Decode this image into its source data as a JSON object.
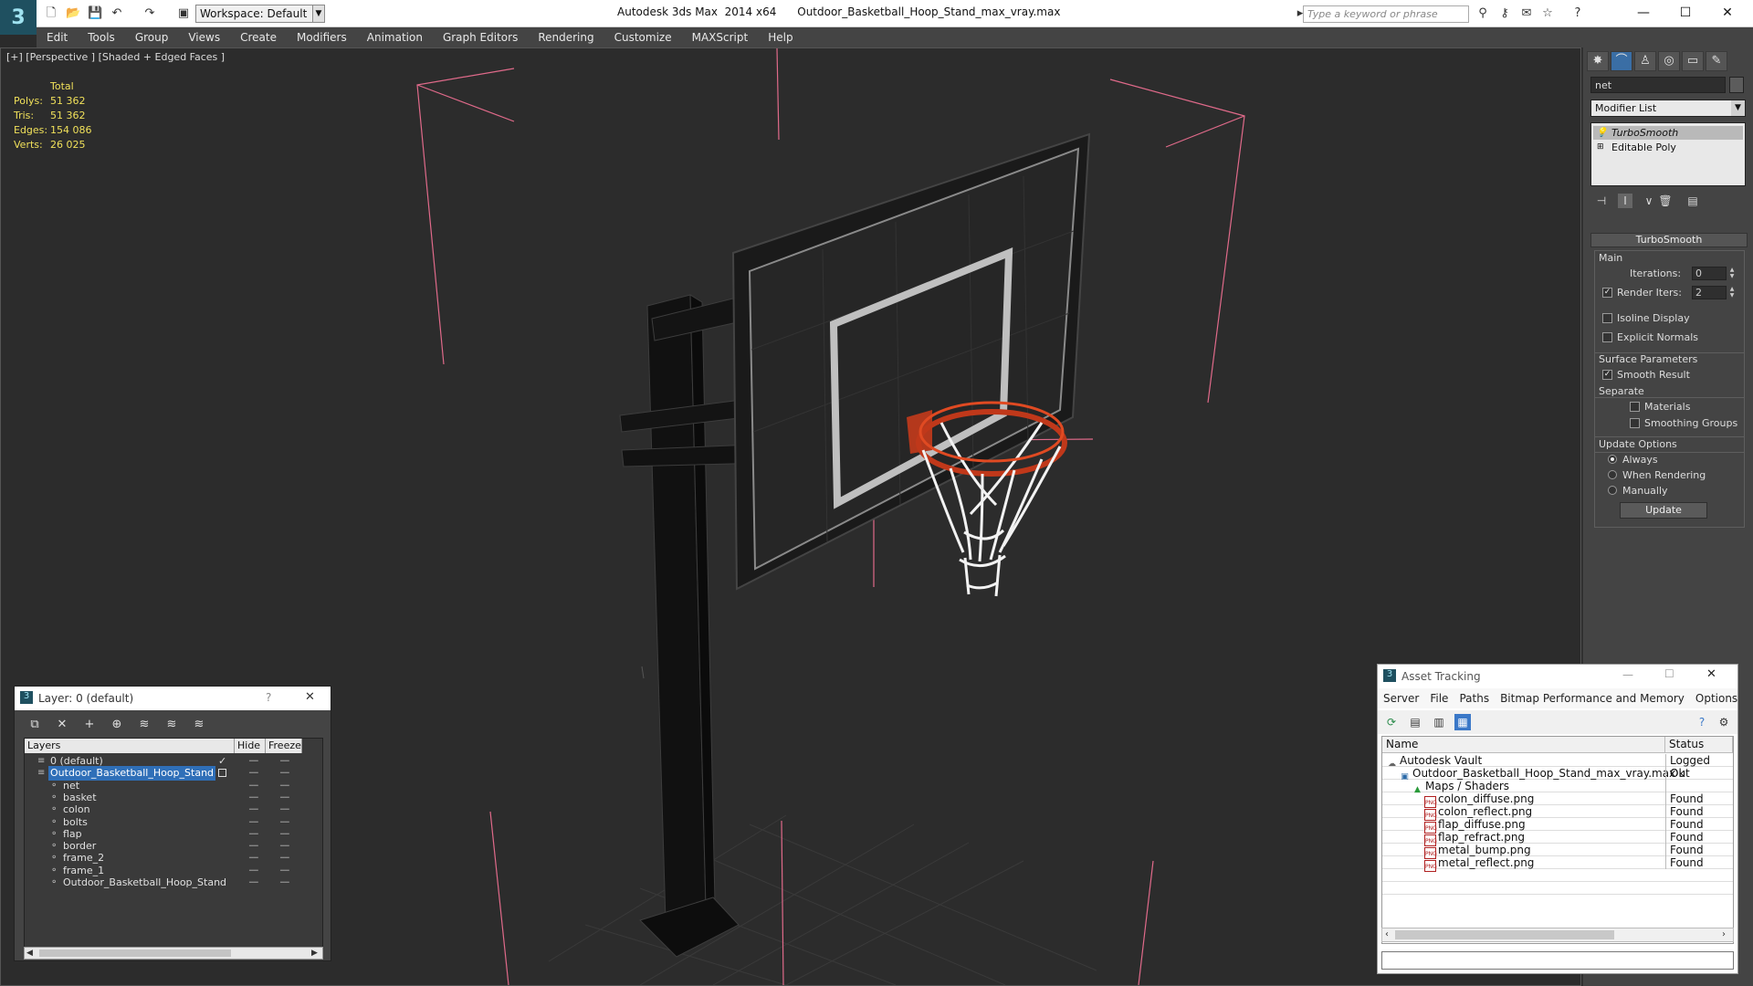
{
  "titlebar": {
    "workspace": "Workspace: Default",
    "window_title": "Autodesk 3ds Max  2014 x64      Outdoor_Basketball_Hoop_Stand_max_vray.max",
    "search_placeholder": "Type a keyword or phrase"
  },
  "menu": [
    "Edit",
    "Tools",
    "Group",
    "Views",
    "Create",
    "Modifiers",
    "Animation",
    "Graph Editors",
    "Rendering",
    "Customize",
    "MAXScript",
    "Help"
  ],
  "viewport": {
    "label": "[+] [Perspective ] [Shaded + Edged Faces ]",
    "stats": {
      "header": "Total",
      "rows": [
        {
          "label": "Polys:",
          "value": "51 362"
        },
        {
          "label": "Tris:",
          "value": "51 362"
        },
        {
          "label": "Edges:",
          "value": "154 086"
        },
        {
          "label": "Verts:",
          "value": "26 025"
        }
      ]
    }
  },
  "command_panel": {
    "object_name": "net",
    "modifier_list": "Modifier List",
    "stack": [
      "TurboSmooth",
      "Editable Poly"
    ],
    "rollout": "TurboSmooth",
    "main_group": "Main",
    "iterations_label": "Iterations:",
    "iterations_value": "0",
    "render_iters_label": "Render Iters:",
    "render_iters_value": "2",
    "isoline_label": "Isoline Display",
    "explicit_normals_label": "Explicit Normals",
    "surface_group": "Surface Parameters",
    "smooth_result_label": "Smooth Result",
    "separate_label": "Separate",
    "materials_label": "Materials",
    "smoothing_groups_label": "Smoothing Groups",
    "update_group": "Update Options",
    "always_label": "Always",
    "when_rendering_label": "When Rendering",
    "manually_label": "Manually",
    "update_button": "Update"
  },
  "layer_dialog": {
    "title": "Layer: 0 (default)",
    "help": "?",
    "columns": [
      "Layers",
      "Hide",
      "Freeze"
    ],
    "rows": [
      {
        "name": "0 (default)",
        "level": 1
      },
      {
        "name": "Outdoor_Basketball_Hoop_Stand",
        "level": 1
      },
      {
        "name": "net",
        "level": 2
      },
      {
        "name": "basket",
        "level": 2
      },
      {
        "name": "colon",
        "level": 2
      },
      {
        "name": "bolts",
        "level": 2
      },
      {
        "name": "flap",
        "level": 2
      },
      {
        "name": "border",
        "level": 2
      },
      {
        "name": "frame_2",
        "level": 2
      },
      {
        "name": "frame_1",
        "level": 2
      },
      {
        "name": "Outdoor_Basketball_Hoop_Stand",
        "level": 2
      }
    ]
  },
  "asset_tracking": {
    "title": "Asset Tracking",
    "menu": [
      "Server",
      "File",
      "Paths",
      "Bitmap Performance and Memory",
      "Options"
    ],
    "columns": [
      "Name",
      "Status"
    ],
    "rows": [
      {
        "name": "Autodesk Vault",
        "status": "Logged Out",
        "level": 0,
        "icon": "vault"
      },
      {
        "name": "Outdoor_Basketball_Hoop_Stand_max_vray.max",
        "status": "Ok",
        "level": 1,
        "icon": "max"
      },
      {
        "name": "Maps / Shaders",
        "status": "",
        "level": 2,
        "icon": "maps"
      },
      {
        "name": "colon_diffuse.png",
        "status": "Found",
        "level": 3,
        "icon": "png"
      },
      {
        "name": "colon_reflect.png",
        "status": "Found",
        "level": 3,
        "icon": "png"
      },
      {
        "name": "flap_diffuse.png",
        "status": "Found",
        "level": 3,
        "icon": "png"
      },
      {
        "name": "flap_refract.png",
        "status": "Found",
        "level": 3,
        "icon": "png"
      },
      {
        "name": "metal_bump.png",
        "status": "Found",
        "level": 3,
        "icon": "png"
      },
      {
        "name": "metal_reflect.png",
        "status": "Found",
        "level": 3,
        "icon": "png"
      }
    ]
  },
  "colors": {
    "selection": "#2f6fb8",
    "stats_text": "#f0e05a",
    "bbox_lines": "#e06a8a",
    "rim": "#c0381a"
  }
}
